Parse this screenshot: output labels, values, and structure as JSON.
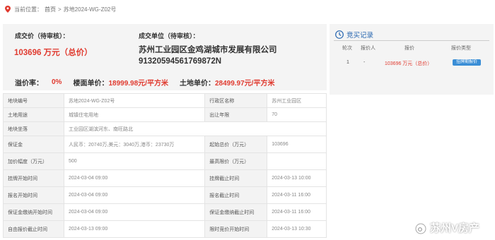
{
  "breadcrumb": {
    "prefix": "当前位置：",
    "home": "首页",
    "sep": ">",
    "current": "苏地2024-WG-Z02号"
  },
  "summary": {
    "deal_price_label": "成交价（待审核）：",
    "deal_price_value": "103696 万元（总价）",
    "deal_unit_label": "成交单位（待审核）：",
    "company_name": "苏州工业园区金鸡湖城市发展有限公司",
    "company_code": "91320594561769872N"
  },
  "stats": {
    "premium_label": "溢价率：",
    "premium_value": "0%",
    "floor_label": "楼面单价：",
    "floor_value": "18999.98元/平方米",
    "land_label": "土地单价：",
    "land_value": "28499.97元/平方米"
  },
  "details": [
    {
      "k1": "地块编号",
      "v1": "苏地2024-WG-Z02号",
      "k2": "行政区名称",
      "v2": "苏州工业园区"
    },
    {
      "k1": "土地用途",
      "v1": "城镇住宅用地",
      "k2": "出让年限",
      "v2": "70"
    },
    {
      "k1": "地块坐落",
      "v1": "工业园区湖滨河东、南旺路北",
      "k2": "",
      "v2": ""
    },
    {
      "k1": "保证金",
      "v1": "人民币：20740万,美元：3040万,港币：23730万",
      "k2": "起始总价（万元）",
      "v2": "103696"
    },
    {
      "k1": "加价幅度（万元）",
      "v1": "500",
      "k2": "最高限价（万元）",
      "v2": ""
    },
    {
      "k1": "挂牌开始时间",
      "v1": "2024-03-04 09:00",
      "k2": "挂牌截止时间",
      "v2": "2024-03-13 10:00"
    },
    {
      "k1": "报名开始时间",
      "v1": "2024-03-04 09:00",
      "k2": "报名截止时间",
      "v2": "2024-03-11 16:00"
    },
    {
      "k1": "保证金缴纳开始时间",
      "v1": "2024-03-04 09:00",
      "k2": "保证金缴纳截止时间",
      "v2": "2024-03-11 16:00"
    },
    {
      "k1": "自由报价截止时间",
      "v1": "2024-03-13 09:00",
      "k2": "限时竞价开始时间",
      "v2": "2024-03-13 10:30"
    }
  ],
  "bid_record": {
    "title": "竞买记录",
    "headers": [
      "轮次",
      "报价人",
      "报价",
      "报价类型"
    ],
    "rows": [
      {
        "round": "1",
        "bidder": "-",
        "price": "103696 万元（总价）",
        "type": "挂牌期报价"
      }
    ]
  },
  "watermark": "苏州V房产",
  "colors": {
    "accent_red": "#e03a2f",
    "link_blue": "#2766b0",
    "badge_blue": "#3a8ed6",
    "panel_bg": "#f4f4f4"
  }
}
